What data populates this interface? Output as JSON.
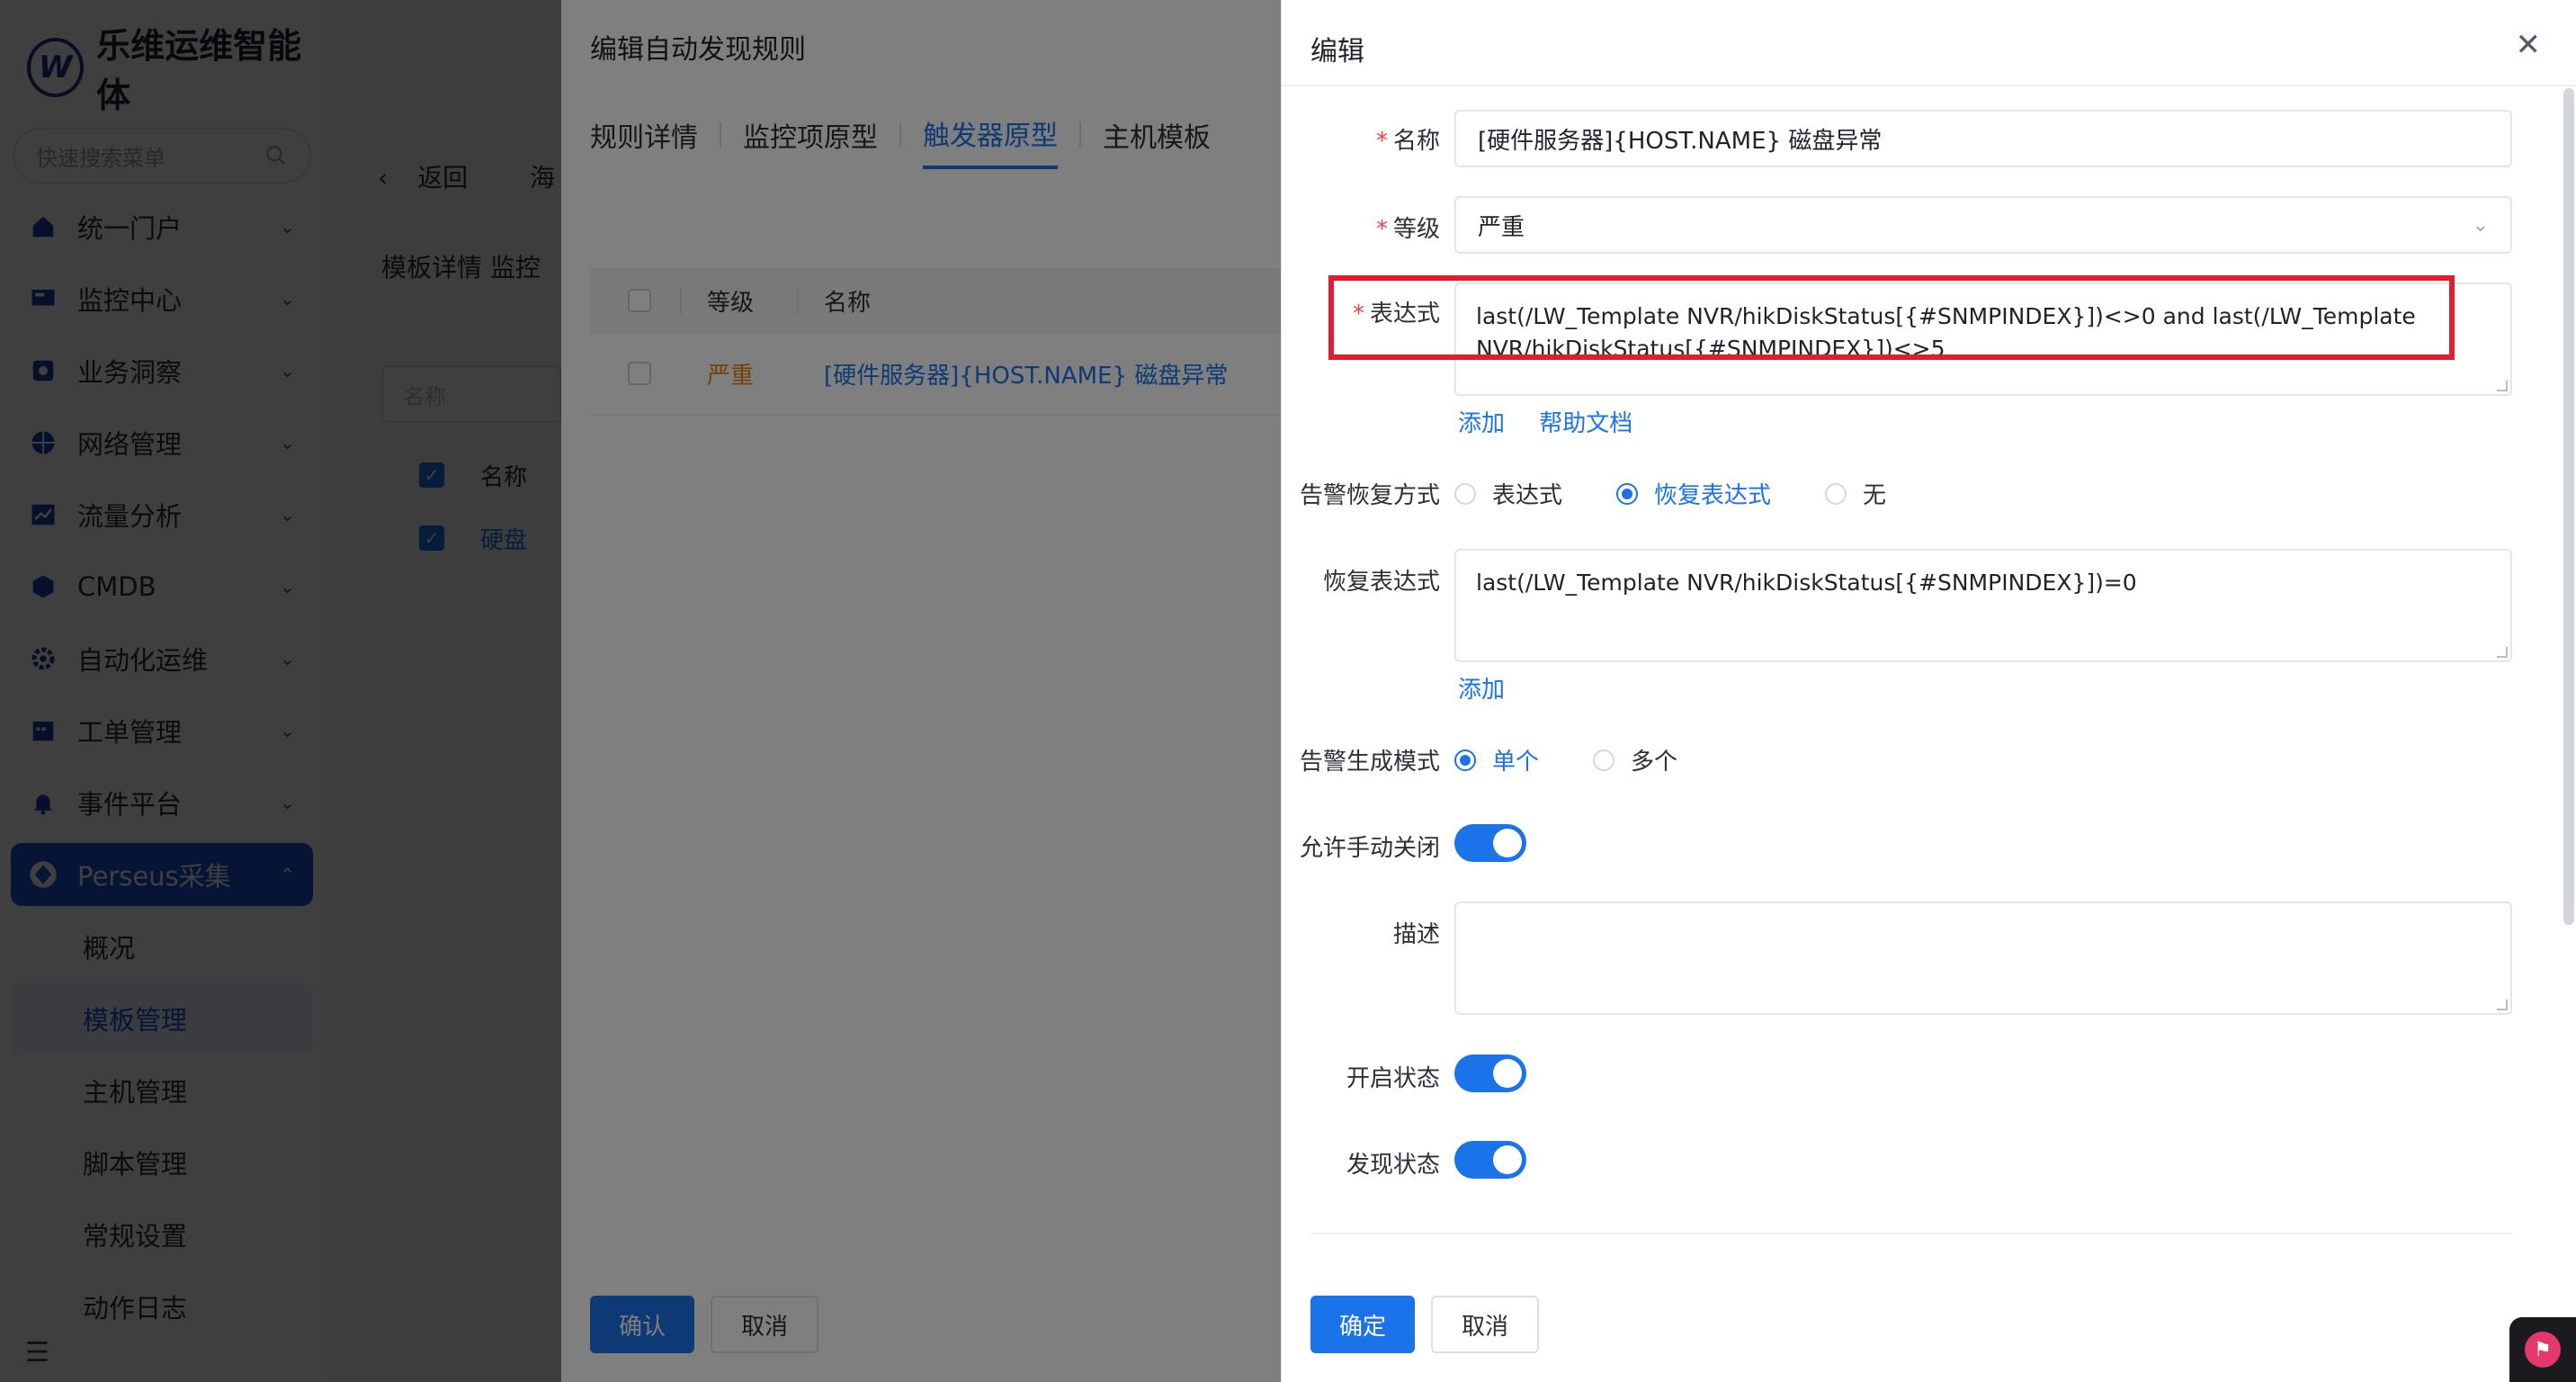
{
  "app": {
    "brand": "乐维运维智能体",
    "search_placeholder": "快速搜索菜单",
    "menu": [
      {
        "label": "统一门户",
        "icon": "home-icon"
      },
      {
        "label": "监控中心",
        "icon": "monitor-icon"
      },
      {
        "label": "业务洞察",
        "icon": "insight-icon"
      },
      {
        "label": "网络管理",
        "icon": "globe-icon"
      },
      {
        "label": "流量分析",
        "icon": "chart-icon"
      },
      {
        "label": "CMDB",
        "icon": "cube-icon"
      },
      {
        "label": "自动化运维",
        "icon": "gear-icon"
      },
      {
        "label": "工单管理",
        "icon": "calendar-icon"
      },
      {
        "label": "事件平台",
        "icon": "bell-icon"
      },
      {
        "label": "Perseus采集",
        "icon": "perseus-icon"
      }
    ],
    "submenu": [
      "概况",
      "模板管理",
      "主机管理",
      "脚本管理",
      "常规设置",
      "动作日志"
    ],
    "back_label": "返回",
    "back_tail": "海",
    "sub_tabs": "模板详情  监控",
    "filter_placeholder": "名称",
    "bg_table": {
      "header": "名称",
      "row": "硬盘"
    }
  },
  "drawer1": {
    "title": "编辑自动发现规则",
    "tabs": [
      "规则详情",
      "监控项原型",
      "触发器原型",
      "主机模板"
    ],
    "active_tab": 2,
    "table": {
      "headers": [
        "等级",
        "名称"
      ],
      "rows": [
        {
          "level": "严重",
          "name": "[硬件服务器]{HOST.NAME} 磁盘异常"
        }
      ]
    },
    "confirm": "确认",
    "cancel": "取消"
  },
  "drawer2": {
    "title": "编辑",
    "fields": {
      "name_label": "名称",
      "name_value": "[硬件服务器]{HOST.NAME} 磁盘异常",
      "level_label": "等级",
      "level_value": "严重",
      "expr_label": "表达式",
      "expr_value": "last(/LW_Template NVR/hikDiskStatus[{#SNMPINDEX}])<>0 and last(/LW_Template NVR/hikDiskStatus[{#SNMPINDEX}])<>5",
      "expr_links": [
        "添加",
        "帮助文档"
      ],
      "recovery_mode_label": "告警恢复方式",
      "recovery_mode_options": [
        "表达式",
        "恢复表达式",
        "无"
      ],
      "recovery_mode_selected": 1,
      "recovery_expr_label": "恢复表达式",
      "recovery_expr_value": "last(/LW_Template NVR/hikDiskStatus[{#SNMPINDEX}])=0",
      "recovery_links": [
        "添加"
      ],
      "gen_mode_label": "告警生成模式",
      "gen_mode_options": [
        "单个",
        "多个"
      ],
      "gen_mode_selected": 0,
      "manual_close_label": "允许手动关闭",
      "manual_close": true,
      "desc_label": "描述",
      "desc_value": "",
      "enabled_label": "开启状态",
      "enabled": true,
      "discover_label": "发现状态",
      "discover": true
    },
    "ok": "确定",
    "cancel": "取消"
  },
  "colors": {
    "primary": "#1a73e8",
    "danger": "#f53f3f",
    "warning": "#e6820e",
    "highlight": "#e11d2e"
  }
}
